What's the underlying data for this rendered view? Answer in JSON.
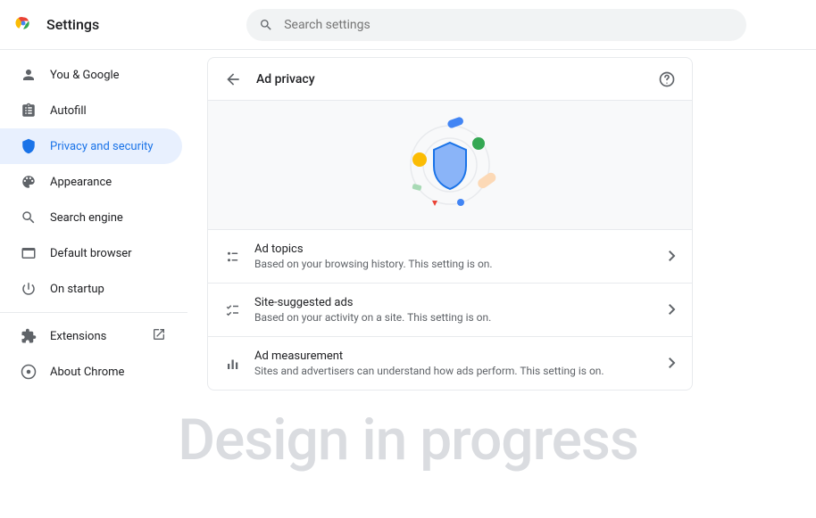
{
  "app": {
    "title": "Settings"
  },
  "search": {
    "placeholder": "Search settings"
  },
  "sidebar": {
    "items": [
      {
        "label": "You & Google"
      },
      {
        "label": "Autofill"
      },
      {
        "label": "Privacy and security"
      },
      {
        "label": "Appearance"
      },
      {
        "label": "Search engine"
      },
      {
        "label": "Default browser"
      },
      {
        "label": "On startup"
      },
      {
        "label": "Extensions"
      },
      {
        "label": "About Chrome"
      }
    ]
  },
  "page": {
    "header": "Ad privacy",
    "rows": [
      {
        "title": "Ad topics",
        "subtitle": "Based on your browsing history. This setting is on."
      },
      {
        "title": "Site-suggested ads",
        "subtitle": "Based on your activity on a site. This setting is on."
      },
      {
        "title": "Ad measurement",
        "subtitle": "Sites and advertisers can understand how ads perform. This setting is on."
      }
    ]
  },
  "watermark": "Design in progress"
}
